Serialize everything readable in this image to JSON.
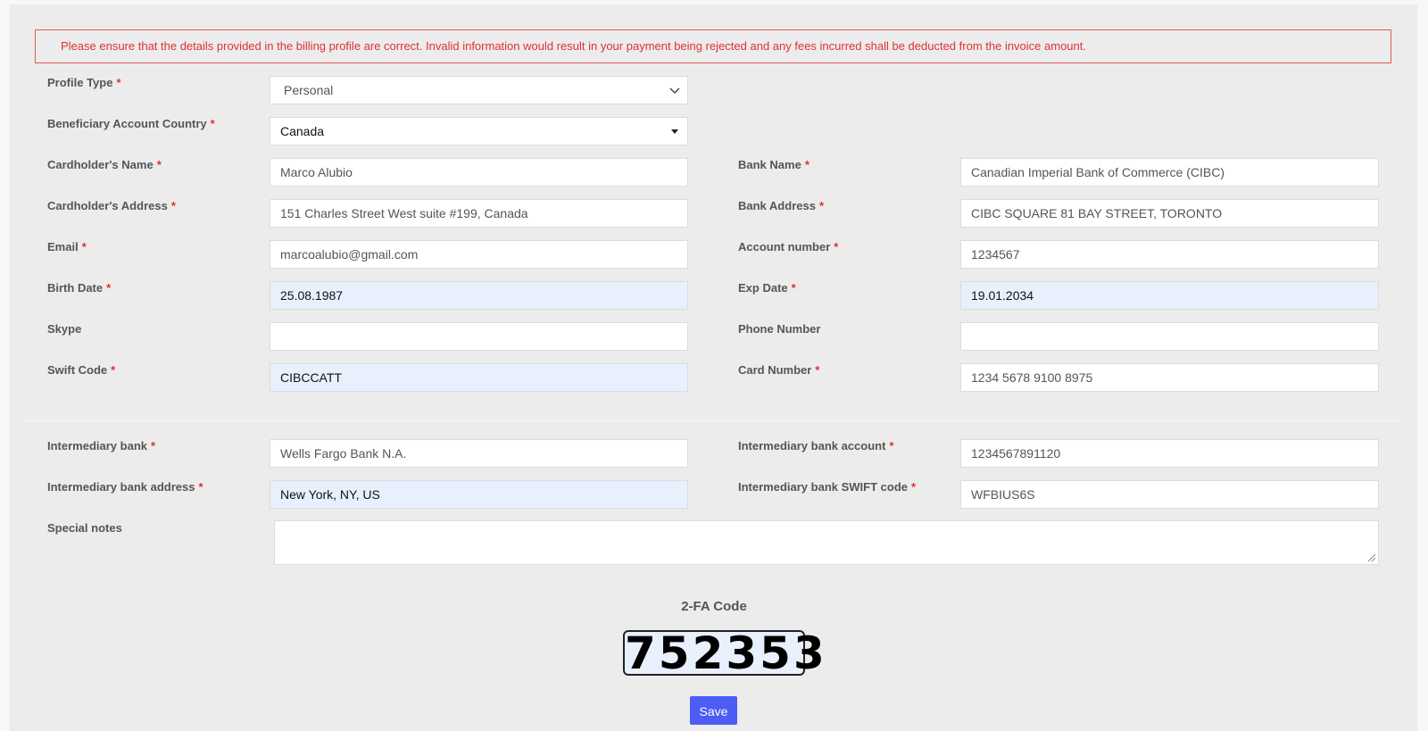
{
  "alert": {
    "text": "Please ensure that the details provided in the billing profile are correct. Invalid information would result in your payment being rejected and any fees incurred shall be deducted from the invoice amount."
  },
  "fields": {
    "profile_type": {
      "label": "Profile Type",
      "required": "*",
      "value": "Personal"
    },
    "beneficiary_country": {
      "label": "Beneficiary Account Country",
      "required": "*",
      "value": "Canada"
    },
    "cardholder_name": {
      "label": "Cardholder's Name",
      "required": "*",
      "value": "Marco Alubio"
    },
    "cardholder_address": {
      "label": "Cardholder's Address",
      "required": "*",
      "value": "151 Charles Street West suite #199, Canada"
    },
    "email": {
      "label": "Email",
      "required": "*",
      "value": "marcoalubio@gmail.com"
    },
    "birth_date": {
      "label": "Birth Date",
      "required": "*",
      "value": "25.08.1987"
    },
    "skype": {
      "label": "Skype",
      "value": ""
    },
    "swift_code": {
      "label": "Swift Code",
      "required": "*",
      "value": "CIBCCATT"
    },
    "bank_name": {
      "label": "Bank Name",
      "required": "*",
      "value": "Canadian Imperial Bank of Commerce (CIBC)"
    },
    "bank_address": {
      "label": "Bank Address",
      "required": "*",
      "value": "CIBC SQUARE 81 BAY STREET, TORONTO"
    },
    "account_number": {
      "label": "Account number",
      "required": "*",
      "value": "1234567"
    },
    "exp_date": {
      "label": "Exp Date",
      "required": "*",
      "value": "19.01.2034"
    },
    "phone_number": {
      "label": "Phone Number",
      "value": ""
    },
    "card_number": {
      "label": "Card Number",
      "required": "*",
      "value": "1234 5678 9100 8975"
    },
    "intermediary_bank": {
      "label": "Intermediary bank",
      "required": "*",
      "value": "Wells Fargo Bank N.A."
    },
    "intermediary_bank_address": {
      "label": "Intermediary bank address",
      "required": "*",
      "value": "New York, NY, US"
    },
    "intermediary_bank_account": {
      "label": "Intermediary bank account",
      "required": "*",
      "value": "1234567891120"
    },
    "intermediary_bank_swift": {
      "label": "Intermediary bank SWIFT code",
      "required": "*",
      "value": "WFBIUS6S"
    },
    "special_notes": {
      "label": "Special notes",
      "value": ""
    }
  },
  "twofa": {
    "label": "2-FA Code",
    "code": "752353"
  },
  "actions": {
    "save_label": "Save"
  },
  "colors": {
    "accent": "#4c5cf4",
    "required": "#e03131",
    "autofill": "#e8f0fe"
  },
  "icons": {
    "profile_type_select": "chevron-down-icon",
    "country_select": "caret-down-icon",
    "textarea_resize": "resize-grip-icon"
  }
}
